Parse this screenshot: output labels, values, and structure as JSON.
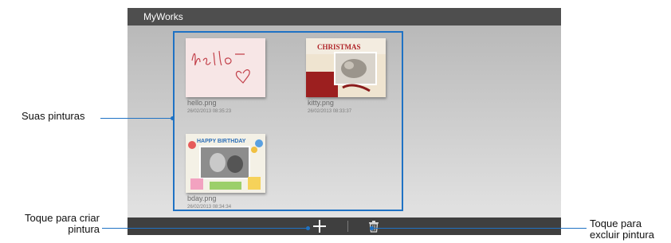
{
  "app": {
    "title": "MyWorks"
  },
  "gallery": {
    "items": [
      {
        "name": "hello.png",
        "date": "26/02/2013 08:35:23",
        "thumb_text": "Hello"
      },
      {
        "name": "kitty.png",
        "date": "26/02/2013 08:33:37",
        "thumb_text": "CHRISTMAS"
      },
      {
        "name": "bday.png",
        "date": "26/02/2013 08:34:34",
        "thumb_text": "HAPPY BIRTHDAY"
      }
    ]
  },
  "toolbar": {
    "add_icon": "plus-icon",
    "delete_icon": "trash-icon"
  },
  "annotations": {
    "paintings": "Suas pinturas",
    "create_line1": "Toque para criar",
    "create_line2": "pintura",
    "delete_line1": "Toque para",
    "delete_line2": "excluir pintura"
  },
  "colors": {
    "accent": "#1f72c4",
    "titlebar": "#4e4e4e",
    "bottombar": "#3f3f3f"
  }
}
